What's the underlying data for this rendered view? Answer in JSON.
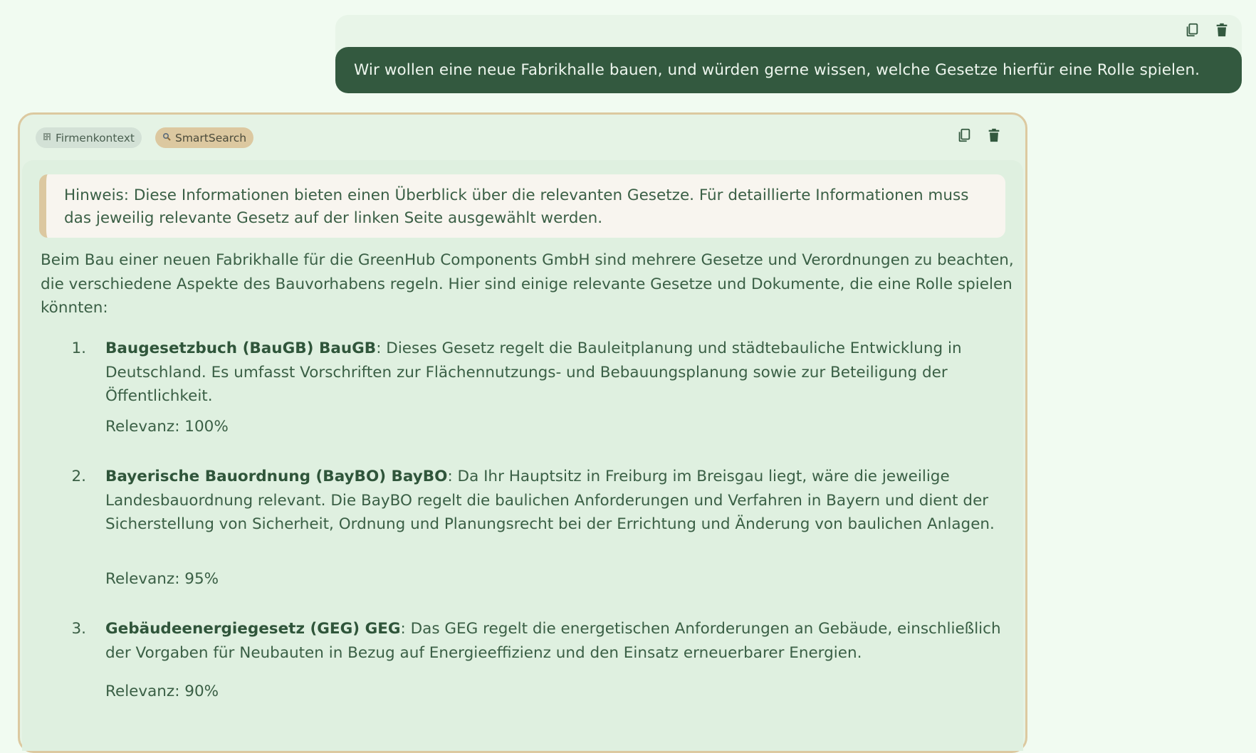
{
  "user_message": {
    "text": "Wir wollen eine neue Fabrikhalle bauen, und würden gerne wissen, welche Gesetze hierfür eine Rolle spielen."
  },
  "icons": {
    "copy": "copy-icon",
    "delete": "trash-icon",
    "firm": "building-icon",
    "search": "magnifier-icon"
  },
  "assistant": {
    "tags": {
      "firm": "Firmenkontext",
      "smart": "SmartSearch"
    },
    "hint": "Hinweis: Diese Informationen bieten einen Überblick über die relevanten Gesetze. Für detaillierte Informationen muss das jeweilig relevante Gesetz auf der linken Seite ausgewählt werden.",
    "intro": "Beim Bau einer neuen Fabrikhalle für die GreenHub Components GmbH sind mehrere Gesetze und Verordnungen zu beachten, die verschiedene Aspekte des Bauvorhabens regeln. Hier sind einige relevante Gesetze und Dokumente, die eine Rolle spielen könnten:",
    "items": [
      {
        "num": "1.",
        "title": "Baugesetzbuch (BauGB) BauGB",
        "text": ": Dieses Gesetz regelt die Bauleitplanung und städtebauliche Entwicklung in Deutschland. Es umfasst Vorschriften zur Flächennutzungs- und Bebauungsplanung sowie zur Beteiligung der Öffentlichkeit.",
        "relevance": "Relevanz: 100%"
      },
      {
        "num": "2.",
        "title": "Bayerische Bauordnung (BayBO) BayBO",
        "text": ": Da Ihr Hauptsitz in Freiburg im Breisgau liegt, wäre die jeweilige Landesbauordnung relevant. Die BayBO regelt die baulichen Anforderungen und Verfahren in Bayern und dient der Sicherstellung von Sicherheit, Ordnung und Planungsrecht bei der Errichtung und Änderung von baulichen Anlagen.",
        "relevance": "Relevanz: 95%"
      },
      {
        "num": "3.",
        "title": "Gebäudeenergiegesetz (GEG) GEG",
        "text": ": Das GEG regelt die energetischen Anforderungen an Gebäude, einschließlich der Vorgaben für Neubauten in Bezug auf Energieeffizienz und den Einsatz erneuerbarer Energien.",
        "relevance": "Relevanz: 90%"
      }
    ]
  }
}
